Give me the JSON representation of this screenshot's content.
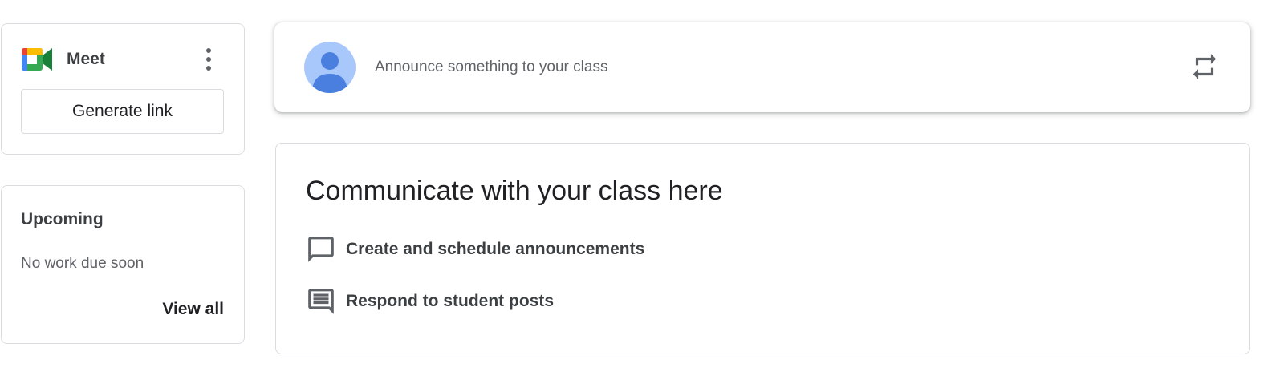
{
  "meet": {
    "title": "Meet",
    "generate_label": "Generate link",
    "logo_icon": "google-meet-icon",
    "menu_icon": "more-vert-icon"
  },
  "upcoming": {
    "title": "Upcoming",
    "empty_text": "No work due soon",
    "view_all_label": "View all"
  },
  "announce": {
    "placeholder": "Announce something to your class",
    "avatar_icon": "user-avatar-icon",
    "repost_icon": "repost-icon"
  },
  "communicate": {
    "heading": "Communicate with your class here",
    "items": [
      {
        "icon": "chat-bubble-icon",
        "label": "Create and schedule announcements"
      },
      {
        "icon": "message-lines-icon",
        "label": "Respond to student posts"
      }
    ]
  },
  "colors": {
    "border": "#dadce0",
    "avatar_bg": "#a8c7fa",
    "avatar_fg": "#4a7fe0",
    "icon_gray": "#5f6368",
    "meet_blue": "#4285f4",
    "meet_red": "#ea4335",
    "meet_yellow": "#fbbc04",
    "meet_green": "#34a853",
    "meet_dark_green": "#188038"
  }
}
